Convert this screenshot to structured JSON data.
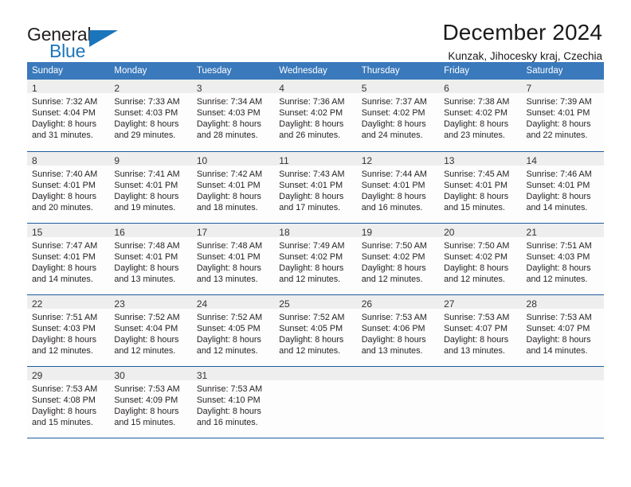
{
  "brand": {
    "name_top": "General",
    "name_bottom": "Blue",
    "accent_color": "#1b75bb",
    "triangle_icon": "triangle-icon"
  },
  "header": {
    "title": "December 2024",
    "subtitle": "Kunzak, Jihocesky kraj, Czechia"
  },
  "calendar": {
    "header_bg": "#3a79bb",
    "header_text_color": "#ffffff",
    "grid_line_color": "#1f5c9e",
    "daynum_bg": "#eeeeee",
    "weekday_headers": [
      "Sunday",
      "Monday",
      "Tuesday",
      "Wednesday",
      "Thursday",
      "Friday",
      "Saturday"
    ],
    "weeks": [
      [
        {
          "day": "1",
          "sunrise": "Sunrise: 7:32 AM",
          "sunset": "Sunset: 4:04 PM",
          "daylight_line1": "Daylight: 8 hours",
          "daylight_line2": "and 31 minutes."
        },
        {
          "day": "2",
          "sunrise": "Sunrise: 7:33 AM",
          "sunset": "Sunset: 4:03 PM",
          "daylight_line1": "Daylight: 8 hours",
          "daylight_line2": "and 29 minutes."
        },
        {
          "day": "3",
          "sunrise": "Sunrise: 7:34 AM",
          "sunset": "Sunset: 4:03 PM",
          "daylight_line1": "Daylight: 8 hours",
          "daylight_line2": "and 28 minutes."
        },
        {
          "day": "4",
          "sunrise": "Sunrise: 7:36 AM",
          "sunset": "Sunset: 4:02 PM",
          "daylight_line1": "Daylight: 8 hours",
          "daylight_line2": "and 26 minutes."
        },
        {
          "day": "5",
          "sunrise": "Sunrise: 7:37 AM",
          "sunset": "Sunset: 4:02 PM",
          "daylight_line1": "Daylight: 8 hours",
          "daylight_line2": "and 24 minutes."
        },
        {
          "day": "6",
          "sunrise": "Sunrise: 7:38 AM",
          "sunset": "Sunset: 4:02 PM",
          "daylight_line1": "Daylight: 8 hours",
          "daylight_line2": "and 23 minutes."
        },
        {
          "day": "7",
          "sunrise": "Sunrise: 7:39 AM",
          "sunset": "Sunset: 4:01 PM",
          "daylight_line1": "Daylight: 8 hours",
          "daylight_line2": "and 22 minutes."
        }
      ],
      [
        {
          "day": "8",
          "sunrise": "Sunrise: 7:40 AM",
          "sunset": "Sunset: 4:01 PM",
          "daylight_line1": "Daylight: 8 hours",
          "daylight_line2": "and 20 minutes."
        },
        {
          "day": "9",
          "sunrise": "Sunrise: 7:41 AM",
          "sunset": "Sunset: 4:01 PM",
          "daylight_line1": "Daylight: 8 hours",
          "daylight_line2": "and 19 minutes."
        },
        {
          "day": "10",
          "sunrise": "Sunrise: 7:42 AM",
          "sunset": "Sunset: 4:01 PM",
          "daylight_line1": "Daylight: 8 hours",
          "daylight_line2": "and 18 minutes."
        },
        {
          "day": "11",
          "sunrise": "Sunrise: 7:43 AM",
          "sunset": "Sunset: 4:01 PM",
          "daylight_line1": "Daylight: 8 hours",
          "daylight_line2": "and 17 minutes."
        },
        {
          "day": "12",
          "sunrise": "Sunrise: 7:44 AM",
          "sunset": "Sunset: 4:01 PM",
          "daylight_line1": "Daylight: 8 hours",
          "daylight_line2": "and 16 minutes."
        },
        {
          "day": "13",
          "sunrise": "Sunrise: 7:45 AM",
          "sunset": "Sunset: 4:01 PM",
          "daylight_line1": "Daylight: 8 hours",
          "daylight_line2": "and 15 minutes."
        },
        {
          "day": "14",
          "sunrise": "Sunrise: 7:46 AM",
          "sunset": "Sunset: 4:01 PM",
          "daylight_line1": "Daylight: 8 hours",
          "daylight_line2": "and 14 minutes."
        }
      ],
      [
        {
          "day": "15",
          "sunrise": "Sunrise: 7:47 AM",
          "sunset": "Sunset: 4:01 PM",
          "daylight_line1": "Daylight: 8 hours",
          "daylight_line2": "and 14 minutes."
        },
        {
          "day": "16",
          "sunrise": "Sunrise: 7:48 AM",
          "sunset": "Sunset: 4:01 PM",
          "daylight_line1": "Daylight: 8 hours",
          "daylight_line2": "and 13 minutes."
        },
        {
          "day": "17",
          "sunrise": "Sunrise: 7:48 AM",
          "sunset": "Sunset: 4:01 PM",
          "daylight_line1": "Daylight: 8 hours",
          "daylight_line2": "and 13 minutes."
        },
        {
          "day": "18",
          "sunrise": "Sunrise: 7:49 AM",
          "sunset": "Sunset: 4:02 PM",
          "daylight_line1": "Daylight: 8 hours",
          "daylight_line2": "and 12 minutes."
        },
        {
          "day": "19",
          "sunrise": "Sunrise: 7:50 AM",
          "sunset": "Sunset: 4:02 PM",
          "daylight_line1": "Daylight: 8 hours",
          "daylight_line2": "and 12 minutes."
        },
        {
          "day": "20",
          "sunrise": "Sunrise: 7:50 AM",
          "sunset": "Sunset: 4:02 PM",
          "daylight_line1": "Daylight: 8 hours",
          "daylight_line2": "and 12 minutes."
        },
        {
          "day": "21",
          "sunrise": "Sunrise: 7:51 AM",
          "sunset": "Sunset: 4:03 PM",
          "daylight_line1": "Daylight: 8 hours",
          "daylight_line2": "and 12 minutes."
        }
      ],
      [
        {
          "day": "22",
          "sunrise": "Sunrise: 7:51 AM",
          "sunset": "Sunset: 4:03 PM",
          "daylight_line1": "Daylight: 8 hours",
          "daylight_line2": "and 12 minutes."
        },
        {
          "day": "23",
          "sunrise": "Sunrise: 7:52 AM",
          "sunset": "Sunset: 4:04 PM",
          "daylight_line1": "Daylight: 8 hours",
          "daylight_line2": "and 12 minutes."
        },
        {
          "day": "24",
          "sunrise": "Sunrise: 7:52 AM",
          "sunset": "Sunset: 4:05 PM",
          "daylight_line1": "Daylight: 8 hours",
          "daylight_line2": "and 12 minutes."
        },
        {
          "day": "25",
          "sunrise": "Sunrise: 7:52 AM",
          "sunset": "Sunset: 4:05 PM",
          "daylight_line1": "Daylight: 8 hours",
          "daylight_line2": "and 12 minutes."
        },
        {
          "day": "26",
          "sunrise": "Sunrise: 7:53 AM",
          "sunset": "Sunset: 4:06 PM",
          "daylight_line1": "Daylight: 8 hours",
          "daylight_line2": "and 13 minutes."
        },
        {
          "day": "27",
          "sunrise": "Sunrise: 7:53 AM",
          "sunset": "Sunset: 4:07 PM",
          "daylight_line1": "Daylight: 8 hours",
          "daylight_line2": "and 13 minutes."
        },
        {
          "day": "28",
          "sunrise": "Sunrise: 7:53 AM",
          "sunset": "Sunset: 4:07 PM",
          "daylight_line1": "Daylight: 8 hours",
          "daylight_line2": "and 14 minutes."
        }
      ],
      [
        {
          "day": "29",
          "sunrise": "Sunrise: 7:53 AM",
          "sunset": "Sunset: 4:08 PM",
          "daylight_line1": "Daylight: 8 hours",
          "daylight_line2": "and 15 minutes."
        },
        {
          "day": "30",
          "sunrise": "Sunrise: 7:53 AM",
          "sunset": "Sunset: 4:09 PM",
          "daylight_line1": "Daylight: 8 hours",
          "daylight_line2": "and 15 minutes."
        },
        {
          "day": "31",
          "sunrise": "Sunrise: 7:53 AM",
          "sunset": "Sunset: 4:10 PM",
          "daylight_line1": "Daylight: 8 hours",
          "daylight_line2": "and 16 minutes."
        },
        {
          "day": "",
          "sunrise": "",
          "sunset": "",
          "daylight_line1": "",
          "daylight_line2": ""
        },
        {
          "day": "",
          "sunrise": "",
          "sunset": "",
          "daylight_line1": "",
          "daylight_line2": ""
        },
        {
          "day": "",
          "sunrise": "",
          "sunset": "",
          "daylight_line1": "",
          "daylight_line2": ""
        },
        {
          "day": "",
          "sunrise": "",
          "sunset": "",
          "daylight_line1": "",
          "daylight_line2": ""
        }
      ]
    ]
  }
}
